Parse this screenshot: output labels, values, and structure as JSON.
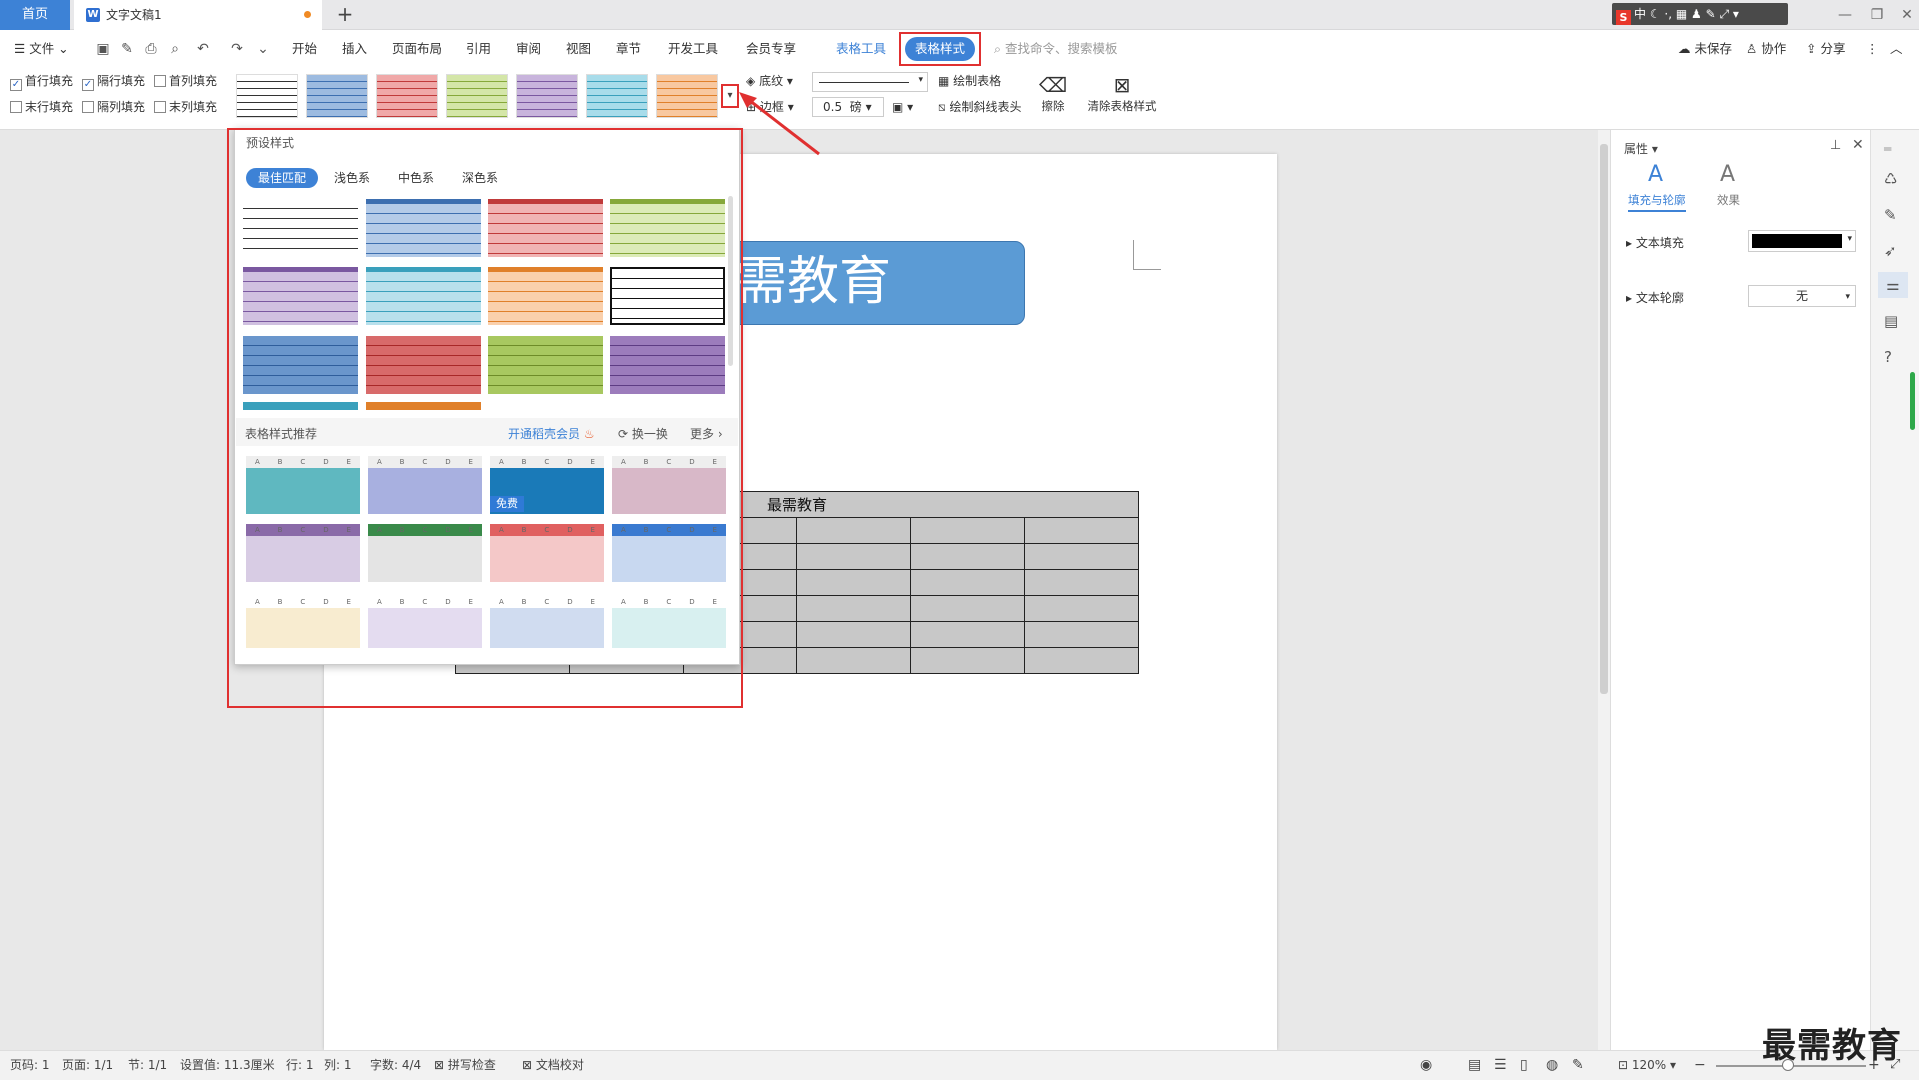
{
  "titlebar": {
    "home_tab": "首页",
    "doc_tab": "文字文稿1",
    "ime": "中"
  },
  "menu": {
    "file": "文件",
    "items": [
      "开始",
      "插入",
      "页面布局",
      "引用",
      "审阅",
      "视图",
      "章节",
      "开发工具",
      "会员专享",
      "表格工具",
      "表格样式"
    ],
    "search_placeholder": "查找命令、搜索模板",
    "unsaved": "未保存",
    "collab": "协作",
    "share": "分享"
  },
  "ribbon": {
    "checks": [
      {
        "label": "首行填充",
        "checked": true
      },
      {
        "label": "隔行填充",
        "checked": true
      },
      {
        "label": "首列填充",
        "checked": false
      },
      {
        "label": "末行填充",
        "checked": false
      },
      {
        "label": "隔列填充",
        "checked": false
      },
      {
        "label": "末列填充",
        "checked": false
      }
    ],
    "shading": "底纹",
    "border": "边框",
    "line_width": "0.5",
    "line_unit": "磅",
    "draw_table": "绘制表格",
    "draw_diag": "绘制斜线表头",
    "erase": "擦除",
    "clear_style": "清除表格样式"
  },
  "dropdown": {
    "title": "预设样式",
    "tabs": [
      "最佳匹配",
      "浅色系",
      "中色系",
      "深色系"
    ],
    "rec_title": "表格样式推荐",
    "vip": "开通稻壳会员",
    "swap": "换一换",
    "more": "更多",
    "free": "免费",
    "cols": [
      "A",
      "B",
      "C",
      "D",
      "E"
    ]
  },
  "document": {
    "title_text": "需教育",
    "table_header": "最需教育"
  },
  "panel": {
    "title": "属性",
    "tab1": "填充与轮廓",
    "tab2": "效果",
    "text_fill": "文本填充",
    "text_outline": "文本轮廓",
    "outline_value": "无"
  },
  "status": {
    "page": "页码: 1",
    "pages": "页面: 1/1",
    "section": "节: 1/1",
    "setting": "设置值: 11.3厘米",
    "row": "行: 1",
    "col": "列: 1",
    "words": "字数: 4/4",
    "spell": "拼写检查",
    "proof": "文档校对",
    "zoom": "120%"
  },
  "watermark": "最需教育",
  "colors": {
    "accent": "#3d82d6",
    "highlight": "#e03030",
    "panel_bg": "#e8e8e8"
  }
}
